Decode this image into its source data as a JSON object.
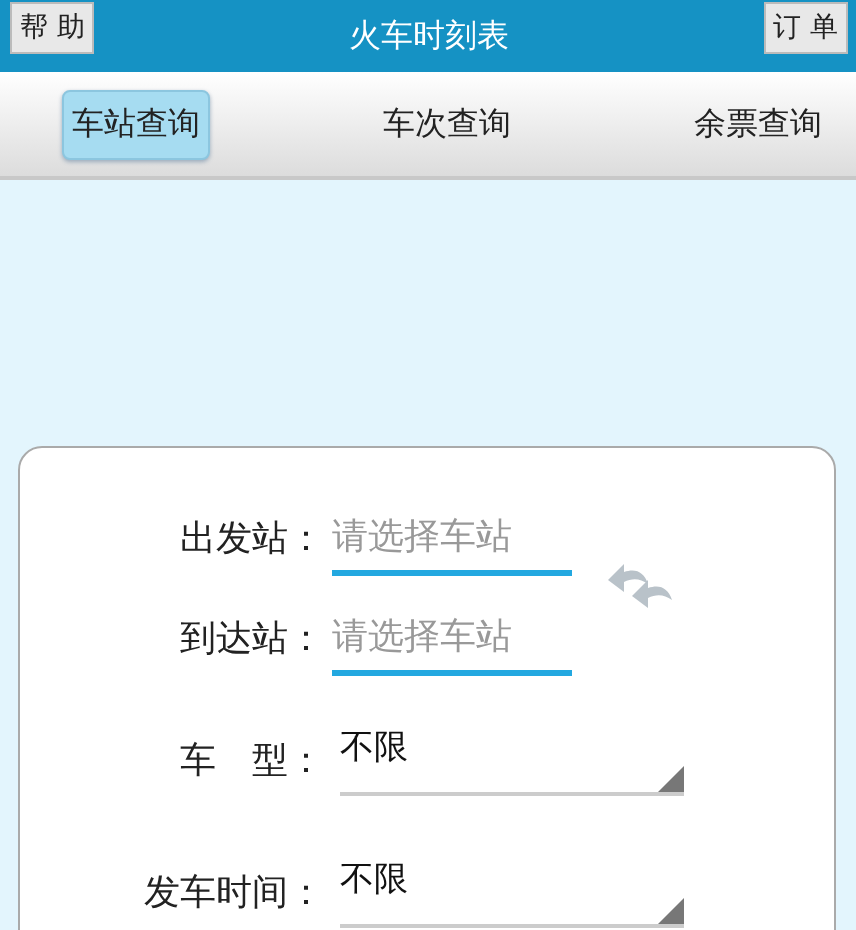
{
  "header": {
    "left_button": "帮 助",
    "title": "火车时刻表",
    "right_button": "订 单"
  },
  "tabs": [
    {
      "label": "车站查询",
      "selected": true
    },
    {
      "label": "车次查询",
      "selected": false
    },
    {
      "label": "余票查询",
      "selected": false
    }
  ],
  "form": {
    "fields": [
      {
        "kind": "station",
        "label": "出发站：",
        "placeholder": "请选择车站"
      },
      {
        "kind": "station",
        "label": "到达站：",
        "placeholder": "请选择车站"
      },
      {
        "kind": "select",
        "label": "车　型：",
        "value": "不限"
      },
      {
        "kind": "select",
        "label": "发车时间：",
        "value": "不限"
      }
    ]
  }
}
